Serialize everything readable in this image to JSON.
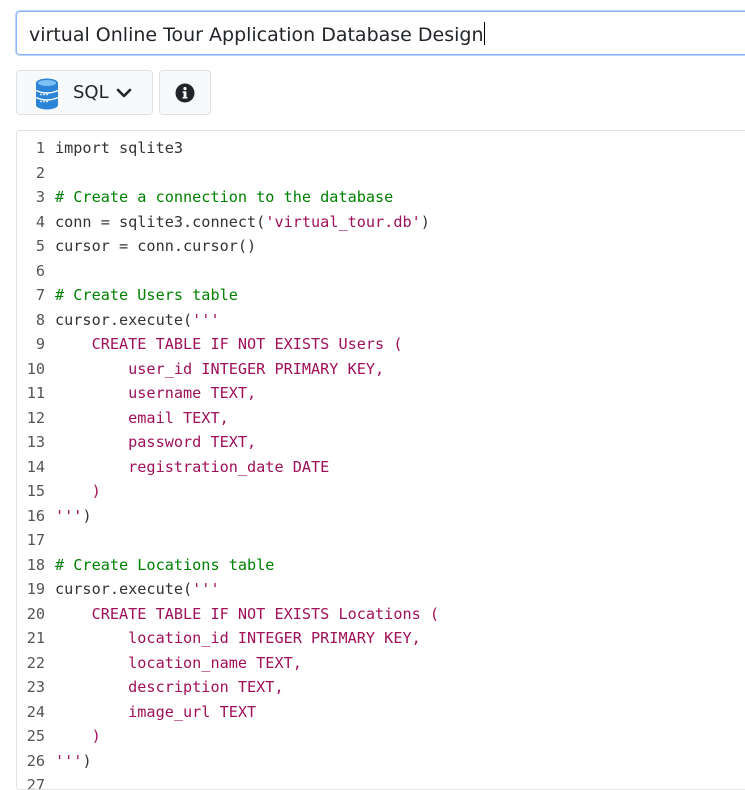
{
  "title_input": {
    "value": "virtual Online Tour Application Database Design"
  },
  "toolbar": {
    "language_label": "SQL",
    "language_icon": "database-icon",
    "dropdown_icon": "chevron-down-icon",
    "info_icon": "info-icon"
  },
  "editor": {
    "lines": [
      {
        "n": "1",
        "text": "import sqlite3",
        "kind": "code"
      },
      {
        "n": "2",
        "text": "",
        "kind": "code"
      },
      {
        "n": "3",
        "text": "# Create a connection to the database",
        "kind": "cm"
      },
      {
        "n": "4",
        "text": "conn = sqlite3.connect('virtual_tour.db')",
        "kind": "mix_connect"
      },
      {
        "n": "5",
        "text": "cursor = conn.cursor()",
        "kind": "code"
      },
      {
        "n": "6",
        "text": "",
        "kind": "code"
      },
      {
        "n": "7",
        "text": "# Create Users table",
        "kind": "cm"
      },
      {
        "n": "8",
        "text": "cursor.execute('''",
        "kind": "mix_exec"
      },
      {
        "n": "9",
        "text": "    CREATE TABLE IF NOT EXISTS Users (",
        "kind": "sql"
      },
      {
        "n": "10",
        "text": "        user_id INTEGER PRIMARY KEY,",
        "kind": "sql"
      },
      {
        "n": "11",
        "text": "        username TEXT,",
        "kind": "sql"
      },
      {
        "n": "12",
        "text": "        email TEXT,",
        "kind": "sql"
      },
      {
        "n": "13",
        "text": "        password TEXT,",
        "kind": "sql"
      },
      {
        "n": "14",
        "text": "        registration_date DATE",
        "kind": "sql"
      },
      {
        "n": "15",
        "text": "    )",
        "kind": "sql"
      },
      {
        "n": "16",
        "text": "''')",
        "kind": "mix_end"
      },
      {
        "n": "17",
        "text": "",
        "kind": "code"
      },
      {
        "n": "18",
        "text": "# Create Locations table",
        "kind": "cm"
      },
      {
        "n": "19",
        "text": "cursor.execute('''",
        "kind": "mix_exec"
      },
      {
        "n": "20",
        "text": "    CREATE TABLE IF NOT EXISTS Locations (",
        "kind": "sql"
      },
      {
        "n": "21",
        "text": "        location_id INTEGER PRIMARY KEY,",
        "kind": "sql"
      },
      {
        "n": "22",
        "text": "        location_name TEXT,",
        "kind": "sql"
      },
      {
        "n": "23",
        "text": "        description TEXT,",
        "kind": "sql"
      },
      {
        "n": "24",
        "text": "        image_url TEXT",
        "kind": "sql"
      },
      {
        "n": "25",
        "text": "    )",
        "kind": "sql"
      },
      {
        "n": "26",
        "text": "''')",
        "kind": "mix_end"
      },
      {
        "n": "27",
        "text": "",
        "kind": "code"
      }
    ]
  },
  "colors": {
    "comment": "#008000",
    "sql_string": "#a0105a",
    "code": "#333333",
    "focus_border": "#8ab4f8",
    "db_icon": "#2b84d8"
  }
}
